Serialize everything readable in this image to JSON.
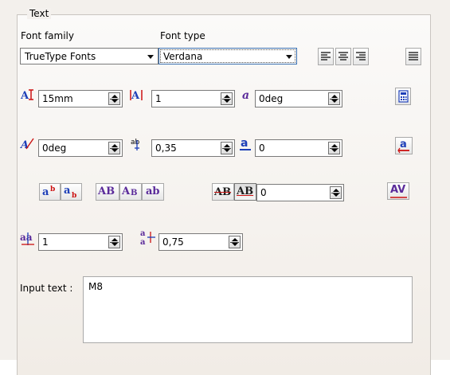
{
  "group_title": "Text",
  "font_family": {
    "label": "Font family",
    "value": "TrueType Fonts"
  },
  "font_type": {
    "label": "Font type",
    "value": "Verdana"
  },
  "row1": {
    "height": "15mm",
    "ratio": "1",
    "slant": "0deg"
  },
  "row2": {
    "orientation": "0deg",
    "spacing": "0,35",
    "underline": "0"
  },
  "row3": {
    "strike": "0"
  },
  "row4": {
    "line_spacing": "1",
    "pitch": "0,75"
  },
  "rich_labels": {
    "sup": "a",
    "sup_small": "b",
    "sub": "a",
    "sub_small": "b",
    "upper": "AB",
    "small_caps_big": "A",
    "small_caps_small": "B",
    "lower": "ab",
    "overline": "AB",
    "frame": "AB",
    "kern": "AV",
    "underline_a": "a"
  },
  "input": {
    "label": "Input text :",
    "value": "M8"
  },
  "colors": {
    "accent_red": "#cc1111",
    "accent_blue": "#1d3fb8",
    "purple": "#5a2a9a"
  }
}
